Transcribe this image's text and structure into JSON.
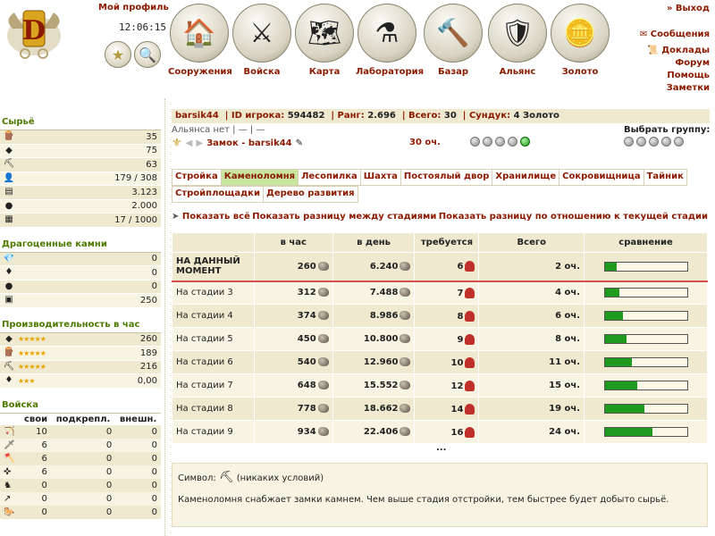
{
  "header": {
    "profile_link": "Мой профиль",
    "time": "12:06:15"
  },
  "nav": [
    {
      "label": "Сооружения",
      "icon": "house-icon",
      "glyph": "🏠"
    },
    {
      "label": "Войска",
      "icon": "swords-icon",
      "glyph": "⚔"
    },
    {
      "label": "Карта",
      "icon": "map-icon",
      "glyph": "🗺"
    },
    {
      "label": "Лаборатория",
      "icon": "flask-icon",
      "glyph": "⚗"
    },
    {
      "label": "Базар",
      "icon": "gavel-icon",
      "glyph": "🔨"
    },
    {
      "label": "Альянс",
      "icon": "shield-icon",
      "glyph": "🛡"
    },
    {
      "label": "Золото",
      "icon": "gold-coin-icon",
      "glyph": "🪙"
    }
  ],
  "right_links": {
    "exit": "» Выход",
    "messages": "Сообщения",
    "reports": "Доклады",
    "forum": "Форум",
    "help": "Помощь",
    "notes": "Заметки"
  },
  "sidebar": {
    "resources_title": "Сырьё",
    "resources": [
      {
        "icon": "wood-icon",
        "value": "35"
      },
      {
        "icon": "stone-icon",
        "value": "75"
      },
      {
        "icon": "ore-icon",
        "value": "63"
      },
      {
        "icon": "worker-icon",
        "value": "179 / 308"
      },
      {
        "icon": "storage-icon",
        "value": "3.123"
      },
      {
        "icon": "coal-icon",
        "value": "2.000"
      },
      {
        "icon": "bricks-icon",
        "value": "17 / 1000"
      }
    ],
    "gems_title": "Драгоценные камни",
    "gems": [
      {
        "icon": "diamond-icon",
        "value": "0"
      },
      {
        "icon": "ruby-icon",
        "value": "0"
      },
      {
        "icon": "emerald-icon",
        "value": "0"
      },
      {
        "icon": "treasure-chest-icon",
        "value": "250"
      }
    ],
    "production_title": "Производительность в час",
    "production": [
      {
        "icon": "stone-icon",
        "stars": "★★★★★",
        "value": "260"
      },
      {
        "icon": "wood-icon",
        "stars": "★★★★★",
        "value": "189"
      },
      {
        "icon": "ore-icon",
        "stars": "★★★★★",
        "value": "216"
      },
      {
        "icon": "ruby-icon",
        "stars": "★★★",
        "value": "0,00"
      }
    ],
    "troops_title": "Войска",
    "troops_headers": [
      "",
      "свои",
      "подкрепл.",
      "внешн."
    ],
    "troops": [
      {
        "icon": "bow-icon",
        "own": "10",
        "reinf": "0",
        "ext": "0"
      },
      {
        "icon": "sword-icon",
        "own": "6",
        "reinf": "0",
        "ext": "0"
      },
      {
        "icon": "axe-icon",
        "own": "6",
        "reinf": "0",
        "ext": "0"
      },
      {
        "icon": "crossbow-icon",
        "own": "6",
        "reinf": "0",
        "ext": "0"
      },
      {
        "icon": "knight-icon",
        "own": "0",
        "reinf": "0",
        "ext": "0"
      },
      {
        "icon": "spear-icon",
        "own": "0",
        "reinf": "0",
        "ext": "0"
      },
      {
        "icon": "horse-icon",
        "own": "0",
        "reinf": "0",
        "ext": "0"
      }
    ]
  },
  "info_bar": {
    "player": "barsik44",
    "id_label": "ID игрока:",
    "id_value": "594482",
    "rank_label": "Ранг:",
    "rank_value": "2.696",
    "total_label": "Всего:",
    "total_value": "30",
    "chest_label": "Сундук:",
    "chest_value": "4 Золото"
  },
  "alliance_text": "Альянса нет | — | —",
  "castle_name": "Замок - barsik44",
  "castle_points": "30 оч.",
  "choose_group": "Выбрать группу:",
  "tabs": [
    "Стройка",
    "Каменоломня",
    "Лесопилка",
    "Шахта",
    "Постоялый двор",
    "Хранилище",
    "Сокровищница",
    "Тайник"
  ],
  "tabs_row2": [
    "Стройплощадки",
    "Дерево развития"
  ],
  "active_tab": "Каменоломня",
  "show_links": {
    "all": "Показать всё",
    "diff_stages": "Показать разницу между стадиями",
    "diff_current": "Показать разницу по отношению к текущей стадии"
  },
  "table": {
    "headers": [
      "",
      "в час",
      "в день",
      "требуется",
      "Всего",
      "сравнение"
    ],
    "rows": [
      {
        "label": "НА ДАННЫЙ МОМЕНТ",
        "per_hour": "260",
        "per_day": "6.240",
        "required": "6",
        "total": "2 оч.",
        "progress": 0.15,
        "current": true
      },
      {
        "label": "На стадии 3",
        "per_hour": "312",
        "per_day": "7.488",
        "required": "7",
        "total": "4 оч.",
        "progress": 0.18
      },
      {
        "label": "На стадии 4",
        "per_hour": "374",
        "per_day": "8.986",
        "required": "8",
        "total": "6 оч.",
        "progress": 0.22
      },
      {
        "label": "На стадии 5",
        "per_hour": "450",
        "per_day": "10.800",
        "required": "9",
        "total": "8 оч.",
        "progress": 0.27
      },
      {
        "label": "На стадии 6",
        "per_hour": "540",
        "per_day": "12.960",
        "required": "10",
        "total": "11 оч.",
        "progress": 0.33
      },
      {
        "label": "На стадии 7",
        "per_hour": "648",
        "per_day": "15.552",
        "required": "12",
        "total": "15 оч.",
        "progress": 0.4
      },
      {
        "label": "На стадии 8",
        "per_hour": "778",
        "per_day": "18.662",
        "required": "14",
        "total": "19 оч.",
        "progress": 0.48
      },
      {
        "label": "На стадии 9",
        "per_hour": "934",
        "per_day": "22.406",
        "required": "16",
        "total": "24 оч.",
        "progress": 0.58
      }
    ]
  },
  "ellipsis": "...",
  "description": {
    "symbol_label": "Символ:",
    "symbol_note": "(никаких условий)",
    "text": "Каменоломня снабжает замки камнем. Чем выше стадия отстройки, тем быстрее будет добыто сырьё."
  }
}
